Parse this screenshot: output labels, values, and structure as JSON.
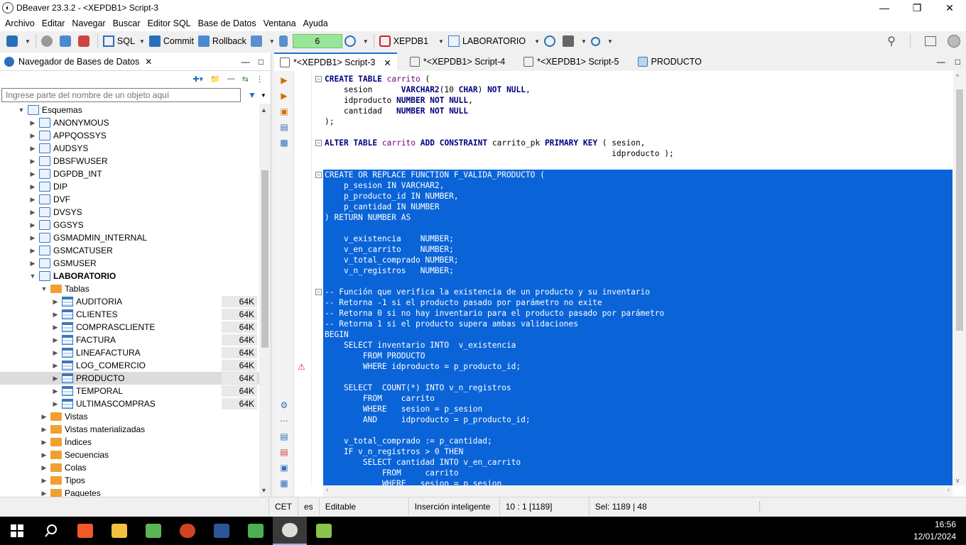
{
  "window": {
    "title": "DBeaver 23.3.2 - <XEPDB1> Script-3"
  },
  "menu": [
    "Archivo",
    "Editar",
    "Navegar",
    "Buscar",
    "Editor SQL",
    "Base de Datos",
    "Ventana",
    "Ayuda"
  ],
  "toolbar": {
    "sql_label": "SQL",
    "commit_label": "Commit",
    "rollback_label": "Rollback",
    "txn_count": "6",
    "connection": "XEPDB1",
    "schema": "LABORATORIO"
  },
  "navigator": {
    "tab_label": "Navegador de Bases de Datos",
    "filter_placeholder": "Ingrese parte del nombre de un objeto aquí",
    "tree": [
      {
        "label": "Esquemas",
        "level": 0,
        "state": "open",
        "kind": "schema"
      },
      {
        "label": "ANONYMOUS",
        "level": 1,
        "state": "closed",
        "kind": "schema"
      },
      {
        "label": "APPQOSSYS",
        "level": 1,
        "state": "closed",
        "kind": "schema"
      },
      {
        "label": "AUDSYS",
        "level": 1,
        "state": "closed",
        "kind": "schema"
      },
      {
        "label": "DBSFWUSER",
        "level": 1,
        "state": "closed",
        "kind": "schema"
      },
      {
        "label": "DGPDB_INT",
        "level": 1,
        "state": "closed",
        "kind": "schema"
      },
      {
        "label": "DIP",
        "level": 1,
        "state": "closed",
        "kind": "schema"
      },
      {
        "label": "DVF",
        "level": 1,
        "state": "closed",
        "kind": "schema"
      },
      {
        "label": "DVSYS",
        "level": 1,
        "state": "closed",
        "kind": "schema"
      },
      {
        "label": "GGSYS",
        "level": 1,
        "state": "closed",
        "kind": "schema"
      },
      {
        "label": "GSMADMIN_INTERNAL",
        "level": 1,
        "state": "closed",
        "kind": "schema"
      },
      {
        "label": "GSMCATUSER",
        "level": 1,
        "state": "closed",
        "kind": "schema"
      },
      {
        "label": "GSMUSER",
        "level": 1,
        "state": "closed",
        "kind": "schema"
      },
      {
        "label": "LABORATORIO",
        "level": 1,
        "state": "open",
        "kind": "schema",
        "bold": true
      },
      {
        "label": "Tablas",
        "level": 2,
        "state": "open",
        "kind": "folder"
      },
      {
        "label": "AUDITORIA",
        "level": 3,
        "state": "closed",
        "kind": "table",
        "size": "64K"
      },
      {
        "label": "CLIENTES",
        "level": 3,
        "state": "closed",
        "kind": "table",
        "size": "64K"
      },
      {
        "label": "COMPRASCLIENTE",
        "level": 3,
        "state": "closed",
        "kind": "table",
        "size": "64K"
      },
      {
        "label": "FACTURA",
        "level": 3,
        "state": "closed",
        "kind": "table",
        "size": "64K"
      },
      {
        "label": "LINEAFACTURA",
        "level": 3,
        "state": "closed",
        "kind": "table",
        "size": "64K"
      },
      {
        "label": "LOG_COMERCIO",
        "level": 3,
        "state": "closed",
        "kind": "table",
        "size": "64K"
      },
      {
        "label": "PRODUCTO",
        "level": 3,
        "state": "closed",
        "kind": "table",
        "size": "64K",
        "selected": true
      },
      {
        "label": "TEMPORAL",
        "level": 3,
        "state": "closed",
        "kind": "table",
        "size": "64K"
      },
      {
        "label": "ULTIMASCOMPRAS",
        "level": 3,
        "state": "closed",
        "kind": "table",
        "size": "64K"
      },
      {
        "label": "Vistas",
        "level": 2,
        "state": "closed",
        "kind": "view"
      },
      {
        "label": "Vistas materializadas",
        "level": 2,
        "state": "closed",
        "kind": "folder"
      },
      {
        "label": "Índices",
        "level": 2,
        "state": "closed",
        "kind": "folder"
      },
      {
        "label": "Secuencias",
        "level": 2,
        "state": "closed",
        "kind": "folder"
      },
      {
        "label": "Colas",
        "level": 2,
        "state": "closed",
        "kind": "folder"
      },
      {
        "label": "Tipos",
        "level": 2,
        "state": "closed",
        "kind": "folder"
      },
      {
        "label": "Paquetes",
        "level": 2,
        "state": "closed",
        "kind": "folder"
      }
    ]
  },
  "editor": {
    "tabs": [
      {
        "label": "*<XEPDB1> Script-3",
        "active": true,
        "closable": true
      },
      {
        "label": "*<XEPDB1> Script-4",
        "active": false
      },
      {
        "label": "*<XEPDB1> Script-5",
        "active": false
      },
      {
        "label": "PRODUCTO",
        "active": false
      }
    ],
    "lines": [
      {
        "text": "CREATE TABLE carrito (",
        "fold": true
      },
      {
        "text": "    sesion      VARCHAR2(10 CHAR) NOT NULL,"
      },
      {
        "text": "    idproducto NUMBER NOT NULL,"
      },
      {
        "text": "    cantidad   NUMBER NOT NULL"
      },
      {
        "text": ");"
      },
      {
        "text": ""
      },
      {
        "text": "ALTER TABLE carrito ADD CONSTRAINT carrito_pk PRIMARY KEY ( sesion,",
        "fold": true
      },
      {
        "text": "                                                            idproducto );"
      },
      {
        "text": ""
      },
      {
        "text": "CREATE OR REPLACE FUNCTION F_VALIDA_PRODUCTO (",
        "fold": true,
        "sel": true
      },
      {
        "text": "    p_sesion IN VARCHAR2,",
        "sel": true
      },
      {
        "text": "    p_producto_id IN NUMBER,",
        "sel": true
      },
      {
        "text": "    p_cantidad IN NUMBER",
        "sel": true
      },
      {
        "text": ") RETURN NUMBER AS",
        "sel": true
      },
      {
        "text": "",
        "sel": true
      },
      {
        "text": "    v_existencia    NUMBER;",
        "sel": true
      },
      {
        "text": "    v_en_carrito    NUMBER;",
        "sel": true
      },
      {
        "text": "    v_total_comprado NUMBER;",
        "sel": true
      },
      {
        "text": "    v_n_registros   NUMBER;",
        "sel": true
      },
      {
        "text": "",
        "sel": true
      },
      {
        "text": "-- Función que verifica la existencia de un producto y su inventario",
        "fold": true,
        "sel": true
      },
      {
        "text": "-- Retorna -1 si el producto pasado por parámetro no exite",
        "sel": true
      },
      {
        "text": "-- Retorna 0 si no hay inventario para el producto pasado por parámetro",
        "sel": true
      },
      {
        "text": "-- Retorna 1 si el producto supera ambas validaciones",
        "sel": true
      },
      {
        "text": "BEGIN",
        "sel": true
      },
      {
        "text": "    SELECT inventario INTO  v_existencia",
        "sel": true
      },
      {
        "text": "        FROM PRODUCTO",
        "sel": true
      },
      {
        "text": "        WHERE idproducto = p_producto_id;",
        "sel": true,
        "warn": true
      },
      {
        "text": "",
        "sel": true
      },
      {
        "text": "    SELECT  COUNT(*) INTO v_n_registros",
        "sel": true
      },
      {
        "text": "        FROM    carrito",
        "sel": true
      },
      {
        "text": "        WHERE   sesion = p_sesion",
        "sel": true
      },
      {
        "text": "        AND     idproducto = p_producto_id;",
        "sel": true
      },
      {
        "text": "",
        "sel": true
      },
      {
        "text": "    v_total_comprado := p_cantidad;",
        "sel": true
      },
      {
        "text": "    IF v_n_registros > 0 THEN",
        "sel": true
      },
      {
        "text": "        SELECT cantidad INTO v_en_carrito",
        "sel": true
      },
      {
        "text": "            FROM     carrito",
        "sel": true
      },
      {
        "text": "            WHERE   sesion = p_sesion",
        "sel": true
      }
    ]
  },
  "status": {
    "timezone": "CET",
    "locale": "es",
    "mode": "Editable",
    "insert": "Inserción inteligente",
    "position": "10 : 1 [1189]",
    "selection": "Sel: 1189 | 48"
  },
  "clock": {
    "time": "16:56",
    "date": "12/01/2024"
  },
  "colors": {
    "selection": "#0a64d8",
    "keyword": "#000080",
    "accent": "#1a73d1"
  }
}
